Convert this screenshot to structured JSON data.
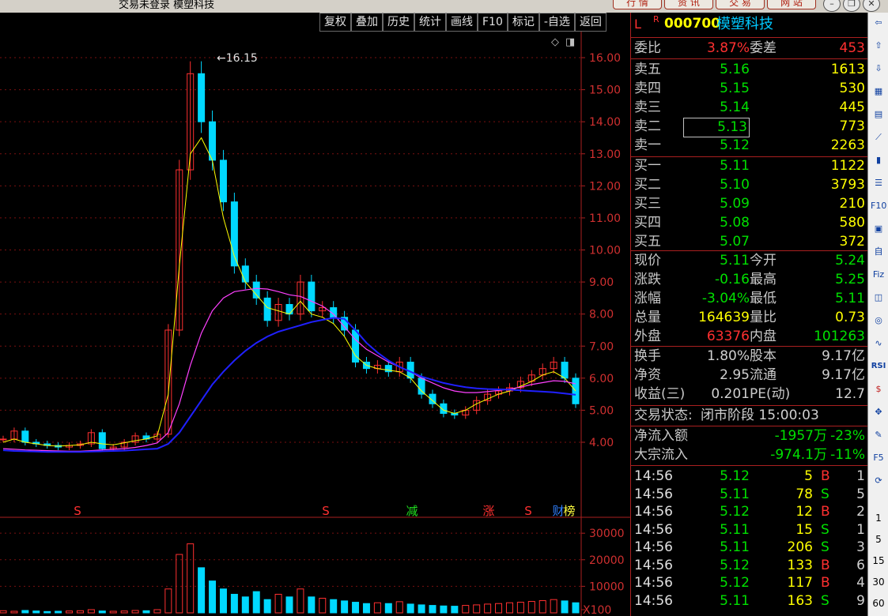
{
  "top": {
    "title": "交易未登录  模塑科技",
    "buttons": [
      "行 情",
      "资 讯",
      "交 易",
      "网 站"
    ],
    "window_controls": [
      "minimize-icon",
      "restore-icon",
      "close-icon"
    ]
  },
  "toolbar": [
    "复权",
    "叠加",
    "历史",
    "统计",
    "画线",
    "F10",
    "标记",
    "-自选",
    "返回"
  ],
  "chart_data": [
    {
      "type": "candlestick-with-moving-averages",
      "price_axis_ticks": [
        "16.00",
        "15.00",
        "14.00",
        "13.00",
        "12.00",
        "11.00",
        "10.00",
        "9.00",
        "8.00",
        "7.00",
        "6.00",
        "5.00",
        "4.00"
      ],
      "ylim": [
        4.0,
        16.0
      ],
      "peak_label": "16.15",
      "event_markers": [
        "S",
        "S",
        "减",
        "涨",
        "S",
        "财",
        "榜"
      ],
      "series": [
        {
          "role": "close",
          "values": [
            4.1,
            4.35,
            4.0,
            3.95,
            3.9,
            3.85,
            3.9,
            3.95,
            4.3,
            3.8,
            3.85,
            4.0,
            4.2,
            4.1,
            4.25,
            7.5,
            12.5,
            15.5,
            14.0,
            12.8,
            11.5,
            9.5,
            9.0,
            8.5,
            7.8,
            8.3,
            8.0,
            9.0,
            8.1,
            8.2,
            7.9,
            7.5,
            6.5,
            6.3,
            6.4,
            6.2,
            6.5,
            6.0,
            5.5,
            5.2,
            4.9,
            4.85,
            5.0,
            5.3,
            5.5,
            5.6,
            5.7,
            5.9,
            6.1,
            6.3,
            6.5,
            6.0,
            5.2
          ]
        },
        {
          "role": "ma-short",
          "values": [
            4.0,
            4.1,
            4.0,
            3.95,
            3.9,
            3.88,
            3.9,
            3.92,
            4.0,
            3.95,
            3.92,
            3.98,
            4.05,
            4.1,
            4.2,
            5.5,
            9.5,
            13.0,
            13.5,
            12.8,
            11.0,
            9.8,
            9.0,
            8.6,
            8.2,
            8.1,
            8.0,
            8.4,
            8.0,
            7.9,
            7.7,
            7.3,
            6.7,
            6.4,
            6.3,
            6.25,
            6.2,
            6.0,
            5.6,
            5.3,
            5.0,
            4.9,
            5.0,
            5.2,
            5.35,
            5.5,
            5.6,
            5.75,
            5.9,
            6.1,
            6.2,
            6.0,
            5.6
          ]
        },
        {
          "role": "ma-long",
          "values": [
            3.8,
            3.78,
            3.76,
            3.75,
            3.74,
            3.73,
            3.72,
            3.72,
            3.74,
            3.76,
            3.78,
            3.8,
            3.84,
            3.9,
            3.98,
            4.3,
            5.2,
            6.4,
            7.4,
            8.1,
            8.5,
            8.7,
            8.75,
            8.8,
            8.78,
            8.7,
            8.6,
            8.55,
            8.4,
            8.25,
            8.0,
            7.6,
            7.2,
            6.9,
            6.7,
            6.5,
            6.35,
            6.2,
            6.0,
            5.85,
            5.7,
            5.6,
            5.55,
            5.55,
            5.58,
            5.62,
            5.66,
            5.72,
            5.8,
            5.86,
            5.92,
            5.9,
            5.82
          ]
        },
        {
          "role": "ma-slow",
          "values": [
            3.75,
            3.73,
            3.72,
            3.71,
            3.7,
            3.7,
            3.7,
            3.7,
            3.71,
            3.72,
            3.73,
            3.74,
            3.76,
            3.78,
            3.8,
            3.95,
            4.3,
            4.8,
            5.3,
            5.8,
            6.2,
            6.55,
            6.85,
            7.1,
            7.3,
            7.45,
            7.55,
            7.65,
            7.75,
            7.82,
            7.88,
            7.85,
            7.5,
            7.1,
            6.8,
            6.55,
            6.35,
            6.2,
            6.05,
            5.95,
            5.85,
            5.78,
            5.72,
            5.68,
            5.66,
            5.65,
            5.64,
            5.62,
            5.6,
            5.58,
            5.56,
            5.52,
            5.48
          ]
        }
      ],
      "volume_axis_ticks": [
        "30000",
        "20000",
        "10000",
        "X100"
      ],
      "volume": [
        800,
        600,
        900,
        700,
        500,
        600,
        700,
        800,
        1200,
        700,
        600,
        700,
        900,
        800,
        1200,
        9000,
        22000,
        26000,
        17000,
        12000,
        9000,
        7000,
        6000,
        8000,
        5000,
        7000,
        6000,
        9000,
        6000,
        5500,
        5000,
        4500,
        4000,
        3500,
        3800,
        3500,
        4200,
        3300,
        3000,
        2800,
        2600,
        2500,
        2800,
        3000,
        3300,
        3500,
        3800,
        4000,
        4300,
        4600,
        5000,
        4500,
        3800
      ]
    }
  ],
  "quote": {
    "flag": "L",
    "flag_sup": "R",
    "code": "000700",
    "name": "模塑科技",
    "weibi_label": "委比",
    "weibi": "3.87%",
    "weicha_label": "委差",
    "weicha": "453",
    "asks": [
      {
        "label": "卖五",
        "price": "5.16",
        "vol": "1613"
      },
      {
        "label": "卖四",
        "price": "5.15",
        "vol": "530"
      },
      {
        "label": "卖三",
        "price": "5.14",
        "vol": "445"
      },
      {
        "label": "卖二",
        "price": "5.13",
        "vol": "773"
      },
      {
        "label": "卖一",
        "price": "5.12",
        "vol": "2263"
      }
    ],
    "bids": [
      {
        "label": "买一",
        "price": "5.11",
        "vol": "1122"
      },
      {
        "label": "买二",
        "price": "5.10",
        "vol": "3793"
      },
      {
        "label": "买三",
        "price": "5.09",
        "vol": "210"
      },
      {
        "label": "买四",
        "price": "5.08",
        "vol": "580"
      },
      {
        "label": "买五",
        "price": "5.07",
        "vol": "372"
      }
    ],
    "stats": [
      {
        "l1": "现价",
        "v1": "5.11",
        "c1": "g",
        "l2": "今开",
        "v2": "5.24",
        "c2": "g"
      },
      {
        "l1": "涨跌",
        "v1": "-0.16",
        "c1": "g",
        "l2": "最高",
        "v2": "5.25",
        "c2": "g"
      },
      {
        "l1": "涨幅",
        "v1": "-3.04%",
        "c1": "g",
        "l2": "最低",
        "v2": "5.11",
        "c2": "g"
      },
      {
        "l1": "总量",
        "v1": "164639",
        "c1": "y",
        "l2": "量比",
        "v2": "0.73",
        "c2": "y"
      },
      {
        "l1": "外盘",
        "v1": "63376",
        "c1": "r",
        "l2": "内盘",
        "v2": "101263",
        "c2": "g"
      }
    ],
    "fund": [
      {
        "l1": "换手",
        "v1": "1.80%",
        "l2": "股本",
        "v2": "9.17亿"
      },
      {
        "l1": "净资",
        "v1": "2.95",
        "l2": "流通",
        "v2": "9.17亿"
      },
      {
        "l1": "收益(三)",
        "v1": "0.201",
        "l2": "PE(动)",
        "v2": "12.7"
      }
    ],
    "status_label": "交易状态:",
    "status": "闭市阶段 15:00:03",
    "flow": [
      {
        "label": "净流入额",
        "val": "-1957万",
        "pct": "-23%"
      },
      {
        "label": "大宗流入",
        "val": "-974.1万",
        "pct": "-11%"
      }
    ],
    "ticks": [
      {
        "t": "14:56",
        "p": "5.12",
        "v": "5",
        "bs": "B",
        "n": "1"
      },
      {
        "t": "14:56",
        "p": "5.11",
        "v": "78",
        "bs": "S",
        "n": "5"
      },
      {
        "t": "14:56",
        "p": "5.12",
        "v": "12",
        "bs": "B",
        "n": "2"
      },
      {
        "t": "14:56",
        "p": "5.11",
        "v": "15",
        "bs": "S",
        "n": "1"
      },
      {
        "t": "14:56",
        "p": "5.11",
        "v": "206",
        "bs": "S",
        "n": "3"
      },
      {
        "t": "14:56",
        "p": "5.12",
        "v": "133",
        "bs": "B",
        "n": "6"
      },
      {
        "t": "14:56",
        "p": "5.12",
        "v": "117",
        "bs": "B",
        "n": "4"
      },
      {
        "t": "14:56",
        "p": "5.11",
        "v": "163",
        "bs": "S",
        "n": "9"
      }
    ]
  },
  "sidebar": {
    "icons": [
      "arrow-left-icon",
      "arrow-up-icon",
      "arrow-down-icon",
      "calc-icon",
      "grid-icon",
      "line-chart-icon",
      "candle-icon",
      "list-icon",
      "f10-icon",
      "file-icon",
      "self-select-icon",
      "fiz-icon",
      "cap-icon",
      "circle-icon",
      "wave-icon",
      "rsi-icon",
      "dollar-icon",
      "move-icon",
      "pen-icon",
      "f5-icon",
      "refresh-icon"
    ],
    "texts": [
      "F10",
      "自",
      "Fiz",
      "RSI",
      "F5",
      "1",
      "5",
      "15",
      "30",
      "60"
    ]
  }
}
